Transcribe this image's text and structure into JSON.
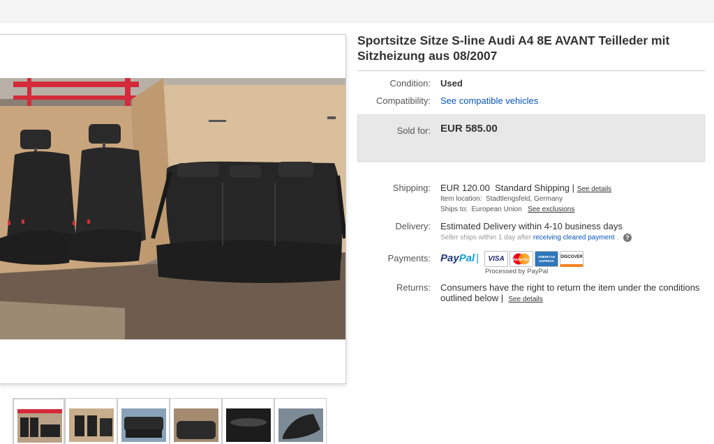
{
  "listing": {
    "title": "Sportsitze Sitze S-line Audi A4 8E AVANT Teilleder mit Sitzheizung aus 08/2007"
  },
  "details": {
    "condition_label": "Condition:",
    "condition_value": "Used",
    "compat_label": "Compatibility:",
    "compat_link": "See compatible vehicles",
    "sold_label": "Sold for:",
    "sold_price": "EUR 585.00",
    "shipping_label": "Shipping:",
    "shipping_cost": "EUR 120.00",
    "shipping_method": "Standard Shipping",
    "shipping_sep": "|",
    "shipping_details_link": "See details",
    "item_location_label": "Item location:",
    "item_location_value": "Stadtlengsfeld, Germany",
    "ships_to_label": "Ships to:",
    "ships_to_value": "European Union",
    "see_exclusions_link": "See exclusions",
    "delivery_label": "Delivery:",
    "delivery_value": "Estimated Delivery within 4-10 business days",
    "seller_ships_text": "Seller ships within 1 day after",
    "cleared_payment_link": "receiving cleared payment",
    "cleared_payment_dot": ".",
    "help_icon_glyph": "?",
    "payments_label": "Payments:",
    "paypal_part1": "Pay",
    "paypal_part2": "Pal",
    "paypal_sep": "|",
    "processed_by": "Processed by PayPal",
    "returns_label": "Returns:",
    "returns_value": "Consumers have the right to return the item under the conditions outlined below |",
    "returns_details_link": "See details"
  },
  "payment_cards": [
    {
      "name": "VISA",
      "color": "#1a1f71"
    },
    {
      "name": "MasterCard",
      "color": "#eb001b"
    },
    {
      "name": "AMERICAN EXPRESS",
      "color": "#2e77bb"
    },
    {
      "name": "DISCOVER",
      "color": "#f58220"
    }
  ],
  "thumbnails": [
    {
      "icon": "seats-set-photo"
    },
    {
      "icon": "seats-set-photo"
    },
    {
      "icon": "rear-bench-photo"
    },
    {
      "icon": "seat-back-photo"
    },
    {
      "icon": "leather-detail-photo"
    },
    {
      "icon": "seat-side-photo"
    }
  ],
  "colors": {
    "link": "#0654ba",
    "price_box": "#e8e8e8",
    "paypal_dark": "#253b80",
    "paypal_light": "#179bd7"
  }
}
